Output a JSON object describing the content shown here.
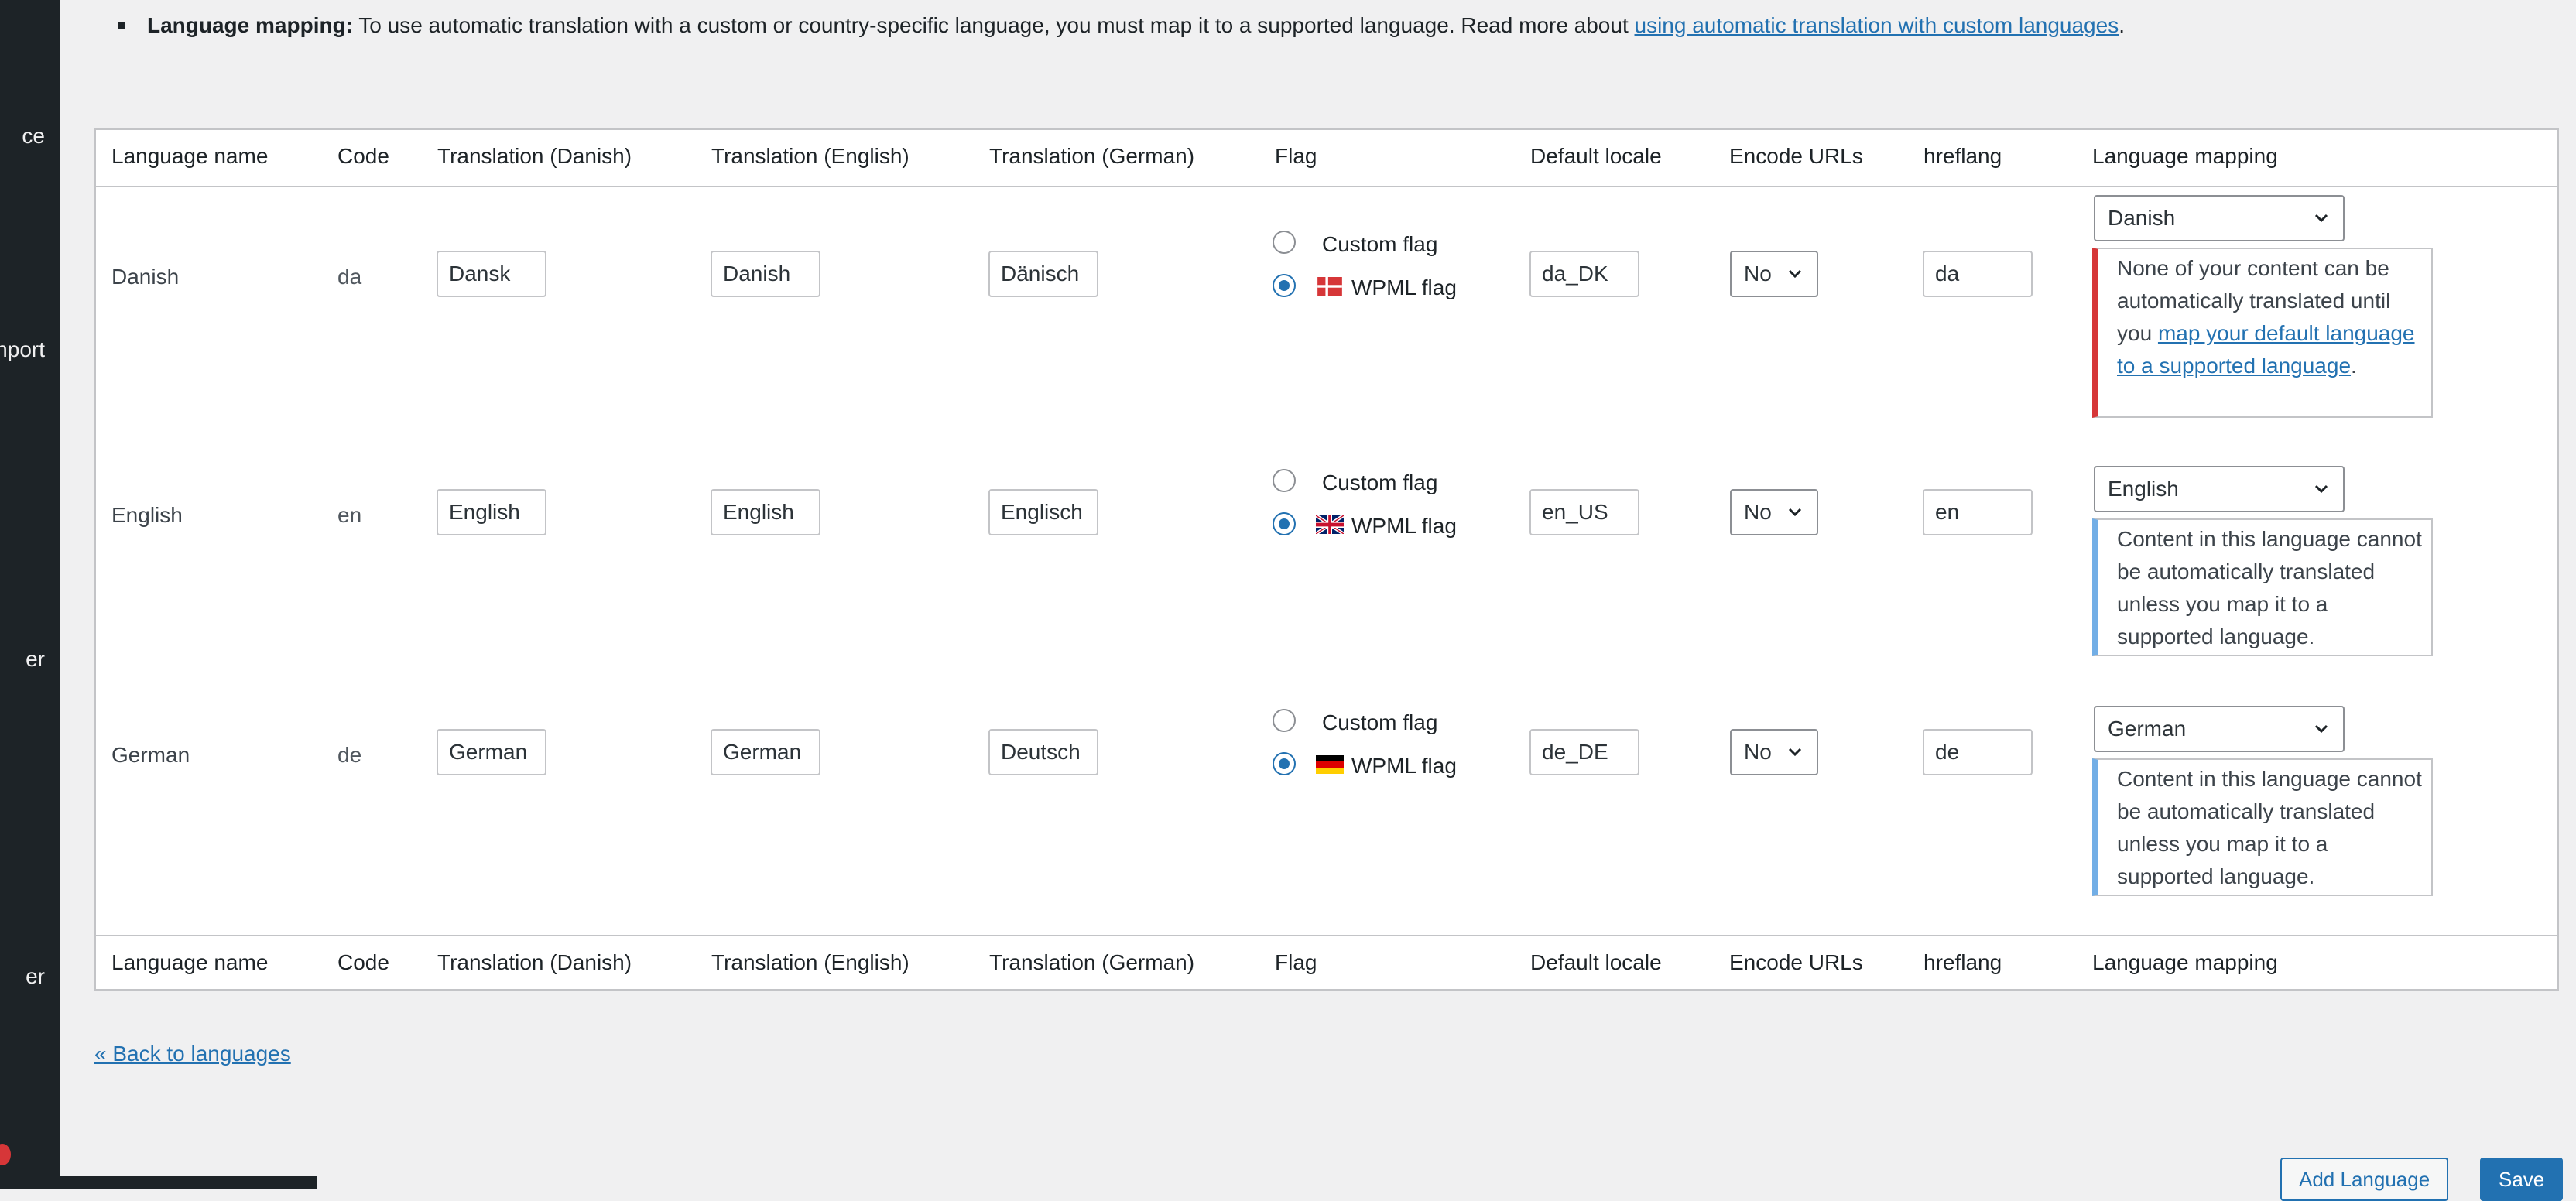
{
  "sidebar": {
    "fragments": [
      "ce",
      "nport",
      "er",
      "er"
    ]
  },
  "note": {
    "title": "Language mapping:",
    "text": " To use automatic translation with a custom or country-specific language, you must map it to a supported language. Read more about ",
    "link": "using automatic translation with custom languages",
    "end": "."
  },
  "table": {
    "headers": [
      "Language name",
      "Code",
      "Translation (Danish)",
      "Translation (English)",
      "Translation (German)",
      "Flag",
      "Default locale",
      "Encode URLs",
      "hreflang",
      "Language mapping"
    ],
    "rows": [
      {
        "name": "Danish",
        "code": "da",
        "t_danish": "Dansk",
        "t_english": "Danish",
        "t_german": "Dänisch",
        "custom_flag": "Custom flag",
        "wpml_flag": "WPML flag",
        "locale": "da_DK",
        "encode": "No",
        "hreflang": "da",
        "mapping": "Danish",
        "notice_pre": "None of your content can be automatically translated until you ",
        "notice_link": "map your default language to a supported language",
        "notice_post": "."
      },
      {
        "name": "English",
        "code": "en",
        "t_danish": "English",
        "t_english": "English",
        "t_german": "Englisch",
        "custom_flag": "Custom flag",
        "wpml_flag": "WPML flag",
        "locale": "en_US",
        "encode": "No",
        "hreflang": "en",
        "mapping": "English",
        "notice": "Content in this language cannot be automatically translated unless you map it to a supported language."
      },
      {
        "name": "German",
        "code": "de",
        "t_danish": "German",
        "t_english": "German",
        "t_german": "Deutsch",
        "custom_flag": "Custom flag",
        "wpml_flag": "WPML flag",
        "locale": "de_DE",
        "encode": "No",
        "hreflang": "de",
        "mapping": "German",
        "notice": "Content in this language cannot be automatically translated unless you map it to a supported language."
      }
    ]
  },
  "back_link": "« Back to languages",
  "buttons": {
    "add_language": "Add Language",
    "save": "Save"
  },
  "colors": {
    "accent": "#2271b1",
    "error": "#d63638",
    "info": "#72aee6"
  }
}
